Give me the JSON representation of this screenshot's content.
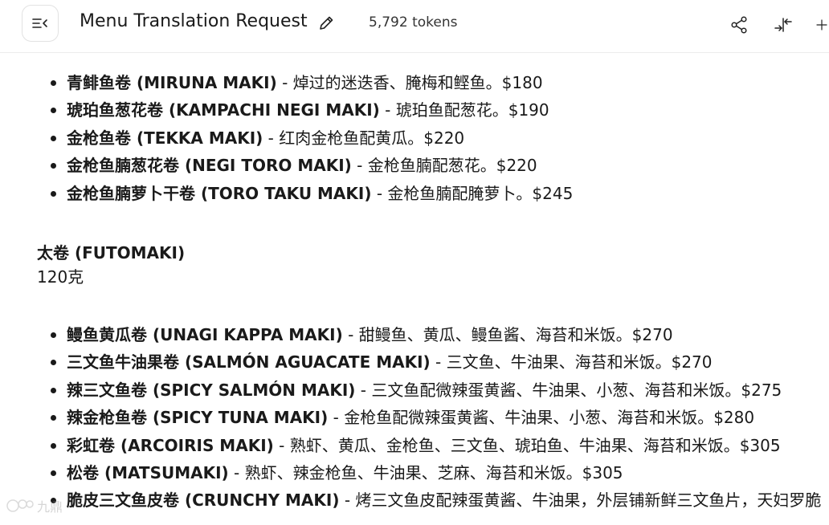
{
  "header": {
    "title": "Menu Translation Request",
    "tokens": "5,792 tokens",
    "icons": [
      "sidebar-toggle-icon",
      "pencil-icon",
      "share-icon",
      "collapse-icon",
      "plus-icon"
    ]
  },
  "content": {
    "list1": [
      {
        "name": "青鲱鱼卷 (MIRUNA MAKI)",
        "desc": " - 焯过的迷迭香、腌梅和鲣鱼。$180"
      },
      {
        "name": "琥珀鱼葱花卷 (KAMPACHI NEGI MAKI)",
        "desc": " - 琥珀鱼配葱花。$190"
      },
      {
        "name": "金枪鱼卷 (TEKKA MAKI)",
        "desc": " - 红肉金枪鱼配黄瓜。$220"
      },
      {
        "name": "金枪鱼腩葱花卷 (NEGI TORO MAKI)",
        "desc": " - 金枪鱼腩配葱花。$220"
      },
      {
        "name": "金枪鱼腩萝卜干卷 (TORO TAKU MAKI)",
        "desc": " - 金枪鱼腩配腌萝卜。$245"
      }
    ],
    "section": {
      "title": "太卷 (FUTOMAKI)",
      "subtitle": "120克"
    },
    "list2": [
      {
        "name": "鳗鱼黄瓜卷 (UNAGI KAPPA MAKI)",
        "desc": " - 甜鳗鱼、黄瓜、鳗鱼酱、海苔和米饭。$270"
      },
      {
        "name": "三文鱼牛油果卷 (SALMÓN AGUACATE MAKI)",
        "desc": " - 三文鱼、牛油果、海苔和米饭。$270"
      },
      {
        "name": "辣三文鱼卷 (SPICY SALMÓN MAKI)",
        "desc": " - 三文鱼配微辣蛋黄酱、牛油果、小葱、海苔和米饭。$275"
      },
      {
        "name": "辣金枪鱼卷 (SPICY TUNA MAKI)",
        "desc": " - 金枪鱼配微辣蛋黄酱、牛油果、小葱、海苔和米饭。$280"
      },
      {
        "name": "彩虹卷 (ARCOIRIS MAKI)",
        "desc": " - 熟虾、黄瓜、金枪鱼、三文鱼、琥珀鱼、牛油果、海苔和米饭。$305"
      },
      {
        "name": "松卷 (MATSUMAKI)",
        "desc": " - 熟虾、辣金枪鱼、牛油果、芝麻、海苔和米饭。$305"
      },
      {
        "name": "脆皮三文鱼皮卷 (CRUNCHY MAKI)",
        "desc": " - 烤三文鱼皮配辣蛋黄酱、牛油果，外层铺新鲜三文鱼片，天妇罗脆"
      }
    ]
  },
  "watermark": {
    "text": "九鼎"
  }
}
